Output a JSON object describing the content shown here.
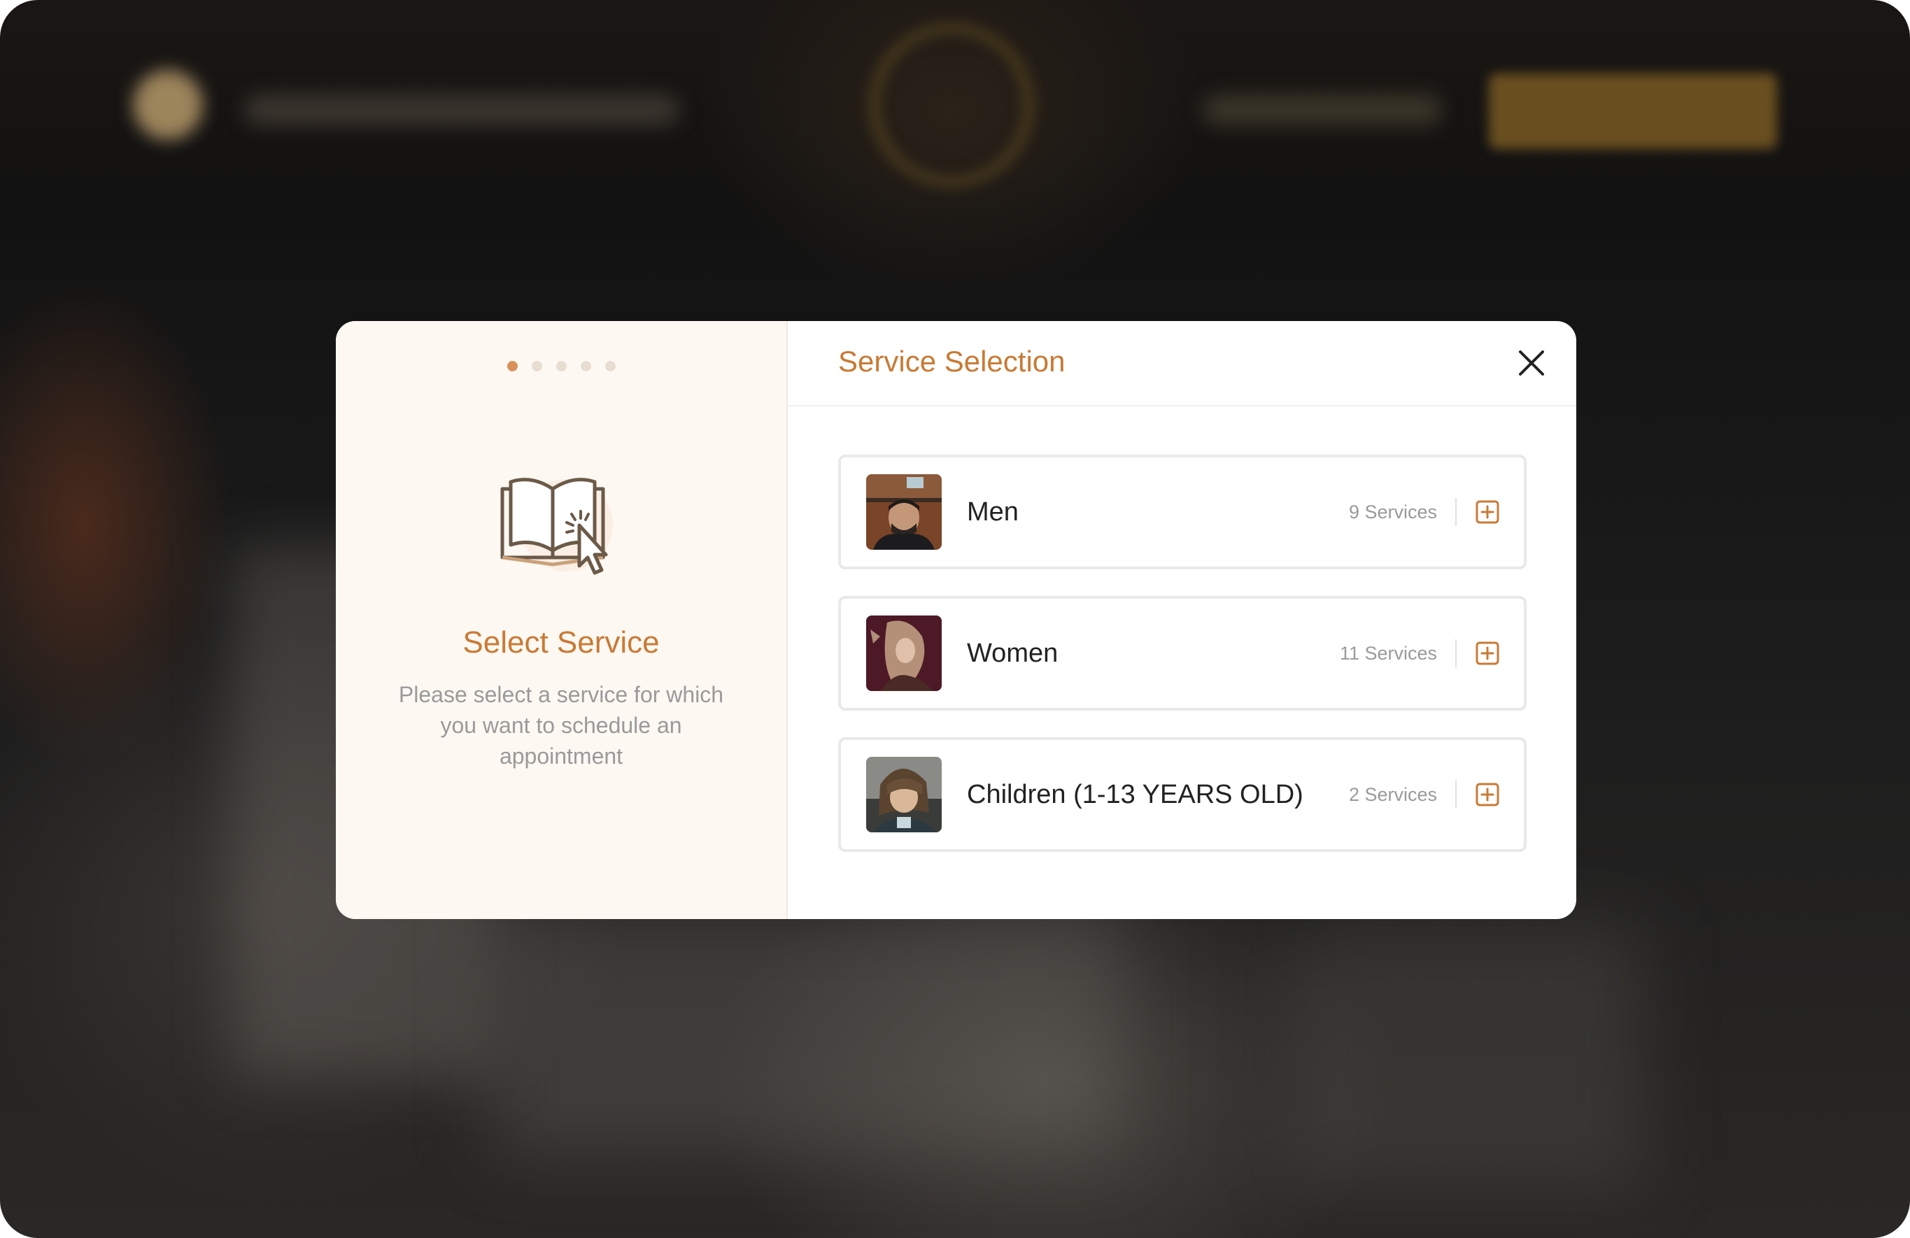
{
  "steps": {
    "count": 5,
    "active_index": 0
  },
  "left_panel": {
    "icon": "book-cursor-icon",
    "title": "Select Service",
    "description": "Please select a service for which you want to schedule an appointment"
  },
  "header": {
    "title": "Service Selection",
    "close_icon": "close-icon"
  },
  "categories": [
    {
      "name": "Men",
      "count": "9 Services",
      "icon": "plus-square-icon"
    },
    {
      "name": "Women",
      "count": "11 Services",
      "icon": "plus-square-icon"
    },
    {
      "name": "Children (1-13 YEARS OLD)",
      "count": "2 Services",
      "icon": "plus-square-icon"
    }
  ],
  "colors": {
    "accent": "#c97a34",
    "left_panel_bg": "#fdf8f2",
    "active_step": "#d9915a"
  }
}
